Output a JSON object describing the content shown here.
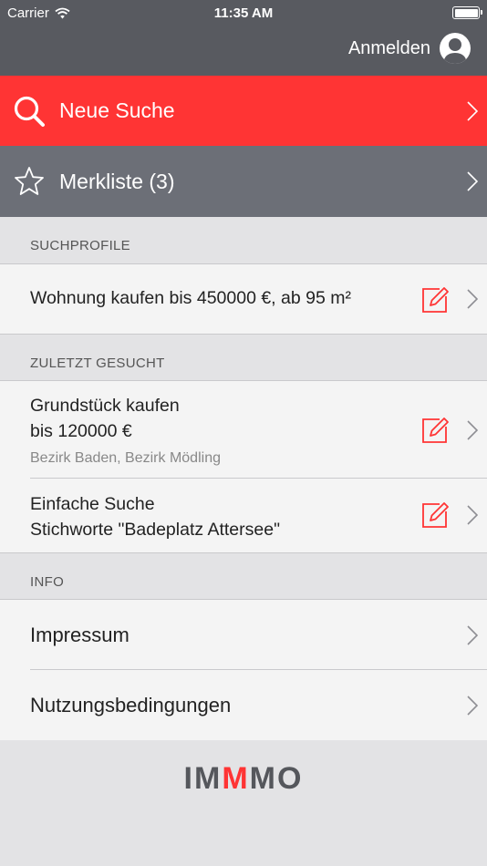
{
  "statusbar": {
    "carrier": "Carrier",
    "time": "11:35 AM"
  },
  "header": {
    "login_label": "Anmelden"
  },
  "menu": {
    "new_search": "Neue Suche",
    "watchlist": "Merkliste (3)"
  },
  "sections": {
    "profiles": "SUCHPROFILE",
    "recent": "ZULETZT GESUCHT",
    "info": "INFO"
  },
  "profiles": [
    {
      "title": "Wohnung kaufen bis 450000 €, ab 95 m²"
    }
  ],
  "recent": [
    {
      "line1": "Grundstück kaufen",
      "line2": "bis 120000 €",
      "sub": "Bezirk Baden, Bezirk Mödling"
    },
    {
      "line1": "Einfache Suche",
      "line2": "Stichworte \"Badeplatz Attersee\""
    }
  ],
  "info": {
    "imprint": "Impressum",
    "terms": "Nutzungsbedingungen"
  },
  "logo": {
    "part1": "IM",
    "part2": "M",
    "part3": "MO"
  },
  "colors": {
    "accent": "#ff3434",
    "dark": "#585a60",
    "watch": "#6c6f77"
  }
}
